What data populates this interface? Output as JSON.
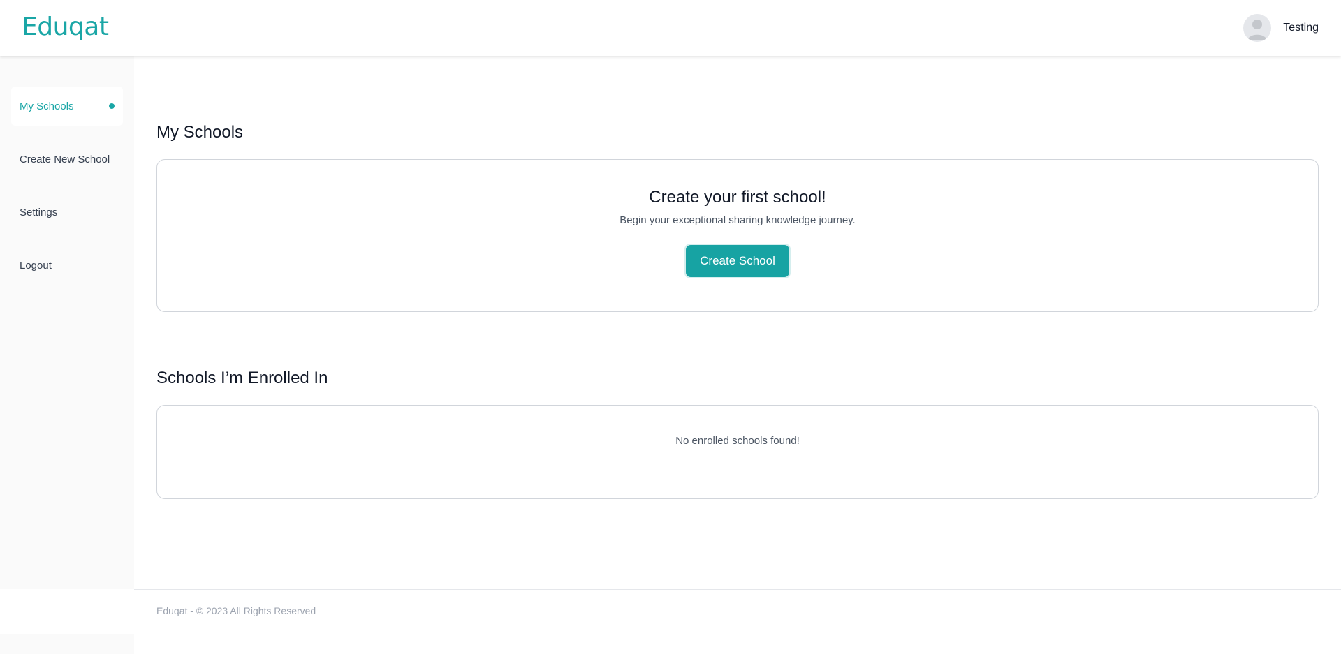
{
  "header": {
    "logo": "Eduqat",
    "user_name": "Testing",
    "avatar_icon": "user-avatar-icon"
  },
  "sidebar": {
    "items": [
      {
        "label": "My Schools",
        "active": true
      },
      {
        "label": "Create New School",
        "active": false
      },
      {
        "label": "Settings",
        "active": false
      },
      {
        "label": "Logout",
        "active": false
      }
    ]
  },
  "main": {
    "my_schools": {
      "title": "My Schools",
      "empty_heading": "Create your first school!",
      "empty_subtext": "Begin your exceptional sharing knowledge journey.",
      "cta_label": "Create School"
    },
    "enrolled": {
      "title": "Schools I’m Enrolled In",
      "empty_text": "No enrolled schools found!"
    }
  },
  "footer": {
    "text": "Eduqat - © 2023 All Rights Reserved"
  },
  "colors": {
    "brand": "#1aa6a6",
    "sidebar_bg": "#fafafa",
    "border": "#d1d5db"
  }
}
